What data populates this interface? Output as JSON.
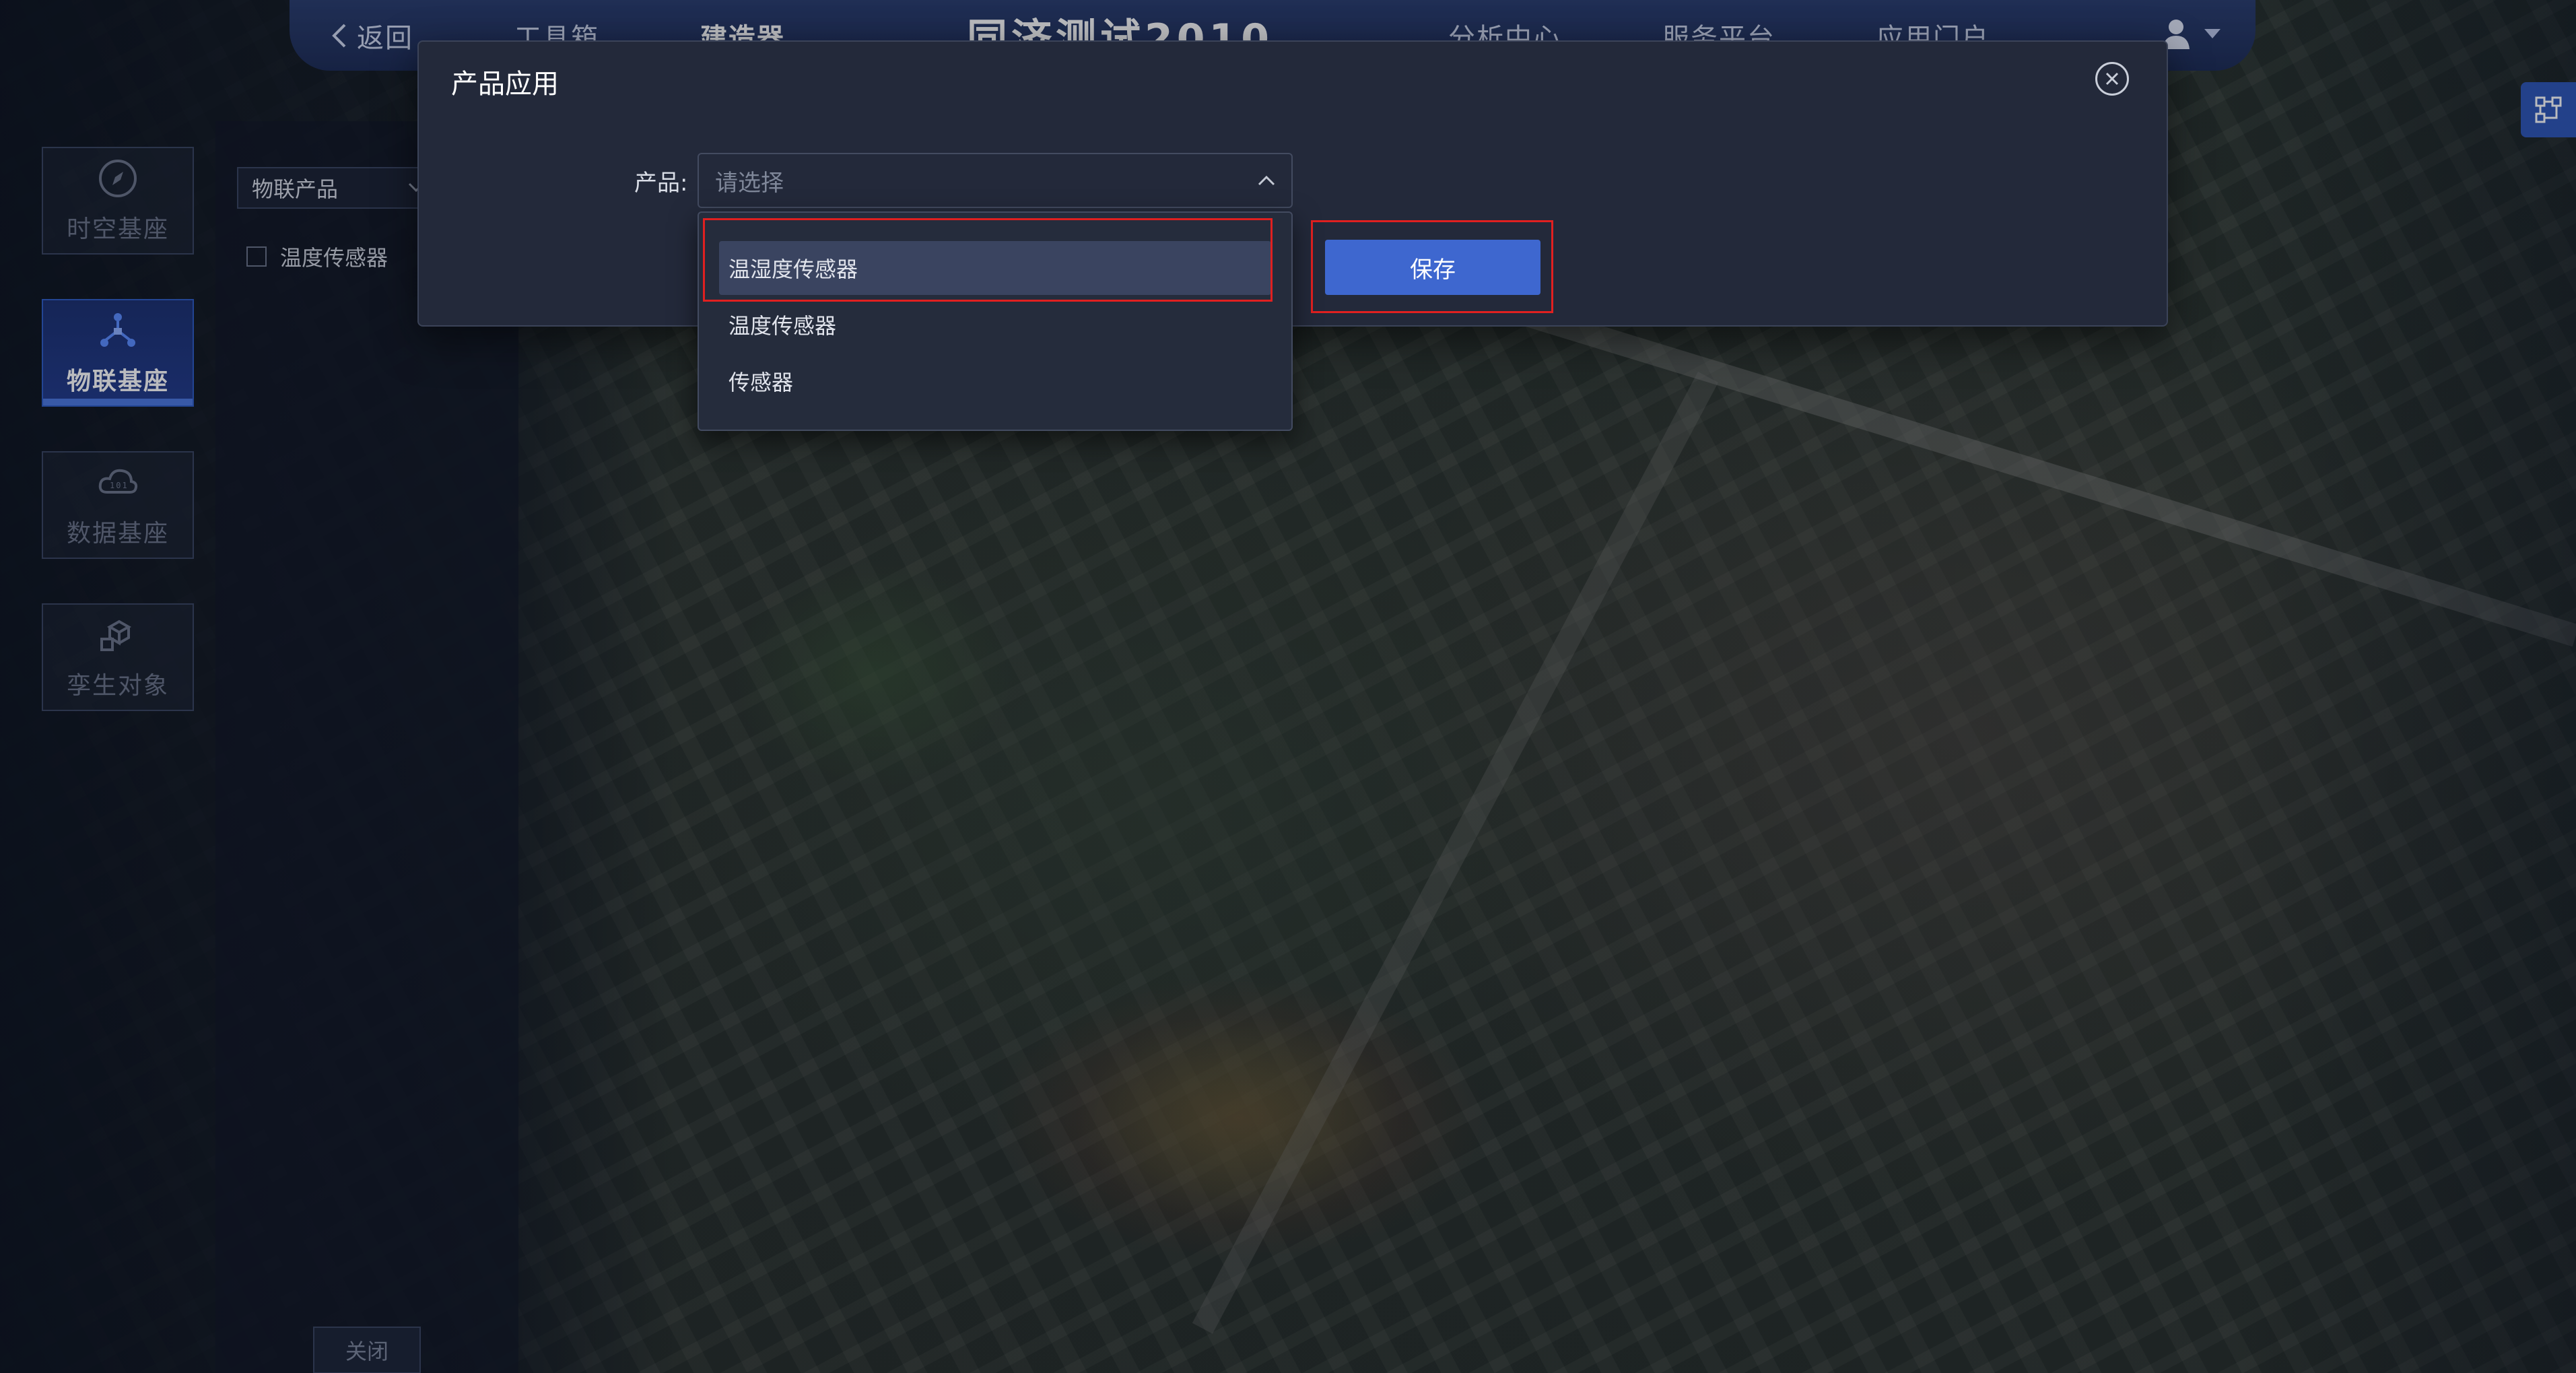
{
  "top_nav": {
    "back_label": "返回",
    "items": [
      "工具箱",
      "建造器"
    ],
    "title": "同济测试2010",
    "right_items": [
      "分析中心",
      "服务平台",
      "应用门户"
    ]
  },
  "sidebar": {
    "items": [
      {
        "label": "时空基座",
        "icon": "compass-icon",
        "active": false
      },
      {
        "label": "物联基座",
        "icon": "iot-network-icon",
        "active": true
      },
      {
        "label": "数据基座",
        "icon": "data-cloud-icon",
        "active": false
      },
      {
        "label": "孪生对象",
        "icon": "cubes-icon",
        "active": false
      }
    ]
  },
  "panel": {
    "select_value": "物联产品",
    "items": [
      "温度传感器"
    ],
    "close_label": "关闭"
  },
  "modal": {
    "title": "产品应用",
    "product_label": "产品:",
    "product_placeholder": "请选择",
    "save_label": "保存",
    "options": [
      "温湿度传感器",
      "温度传感器",
      "传感器"
    ],
    "selected_option": "温湿度传感器"
  },
  "colors": {
    "accent": "#3e67cf",
    "modal_bg": "#23293a",
    "highlight": "#e02020"
  }
}
